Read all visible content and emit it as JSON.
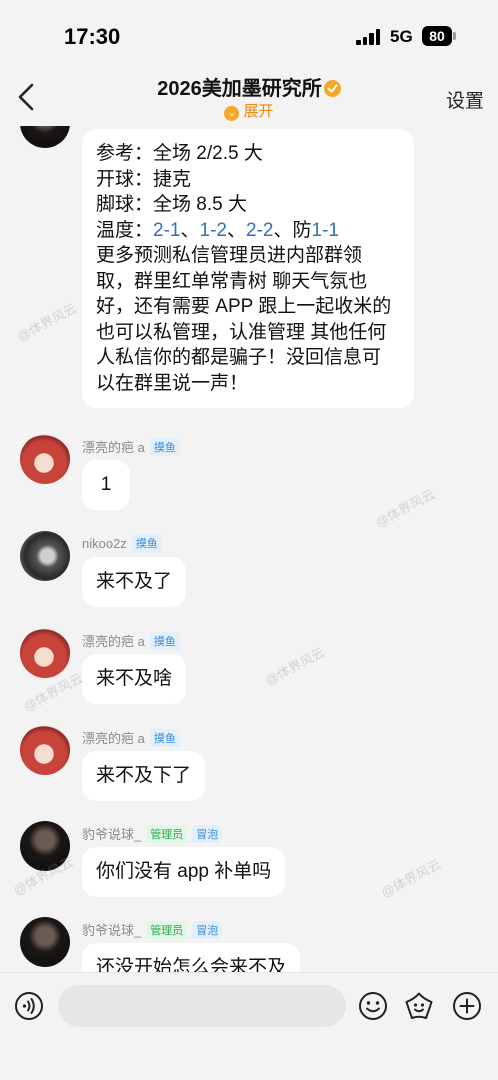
{
  "status_bar": {
    "time": "17:30",
    "network": "5G",
    "battery": "80"
  },
  "header": {
    "title": "2026美加墨研究所",
    "expand_label": "展开",
    "settings_label": "设置"
  },
  "pinned_message": {
    "lines": [
      {
        "parts": [
          {
            "text": "参考：全场 2/2.5 大"
          }
        ]
      },
      {
        "parts": [
          {
            "text": "开球：捷克"
          }
        ]
      },
      {
        "parts": [
          {
            "text": "脚球：全场 8.5 大"
          }
        ]
      },
      {
        "parts": [
          {
            "text": "温度："
          },
          {
            "text": "2-1",
            "link": true
          },
          {
            "text": "、"
          },
          {
            "text": "1-2",
            "link": true
          },
          {
            "text": "、"
          },
          {
            "text": "2-2",
            "link": true
          },
          {
            "text": "、防"
          },
          {
            "text": "1-1",
            "link": true
          }
        ]
      },
      {
        "parts": [
          {
            "text": "更多预测私信管理员进内部群领"
          }
        ]
      },
      {
        "parts": [
          {
            "text": "取，群里红单常青树 聊天气氛也"
          }
        ]
      },
      {
        "parts": [
          {
            "text": "好，还有需要 APP 跟上一起收米的"
          }
        ]
      },
      {
        "parts": [
          {
            "text": "也可以私管理，认准管理 其他任何"
          }
        ]
      },
      {
        "parts": [
          {
            "text": "人私信你的都是骗子！没回信息可"
          }
        ]
      },
      {
        "parts": [
          {
            "text": "以在群里说一声！"
          }
        ]
      }
    ]
  },
  "messages": [
    {
      "sender": "漂亮的疤 a",
      "avatar": "anime-avatar",
      "tags": [
        {
          "text": "摸鱼",
          "color": "#3a8bd6"
        }
      ],
      "text": "1"
    },
    {
      "sender": "nikoo2z",
      "avatar": "bw-avatar",
      "tags": [
        {
          "text": "摸鱼",
          "color": "#3a8bd6"
        }
      ],
      "text": "来不及了"
    },
    {
      "sender": "漂亮的疤 a",
      "avatar": "anime-avatar",
      "tags": [
        {
          "text": "摸鱼",
          "color": "#3a8bd6"
        }
      ],
      "text": "来不及啥"
    },
    {
      "sender": "漂亮的疤 a",
      "avatar": "anime-avatar",
      "tags": [
        {
          "text": "摸鱼",
          "color": "#3a8bd6"
        }
      ],
      "text": "来不及下了"
    },
    {
      "sender": "豹爷说球_",
      "avatar": "dark-avatar",
      "tags": [
        {
          "text": "管理员",
          "color": "#2eaa55"
        },
        {
          "text": "冒泡",
          "color": "#3a8bd6"
        }
      ],
      "text": "你们没有 app 补单吗"
    },
    {
      "sender": "豹爷说球_",
      "avatar": "dark-avatar",
      "tags": [
        {
          "text": "管理员",
          "color": "#2eaa55"
        },
        {
          "text": "冒泡",
          "color": "#3a8bd6"
        }
      ],
      "text": "还没开始怎么会来不及"
    }
  ],
  "watermark": "@体界风云",
  "input_bar": {
    "placeholder": ""
  },
  "colors": {
    "background": "#f3f3f3",
    "accent": "#f3a826",
    "link": "#2f6fc4"
  }
}
